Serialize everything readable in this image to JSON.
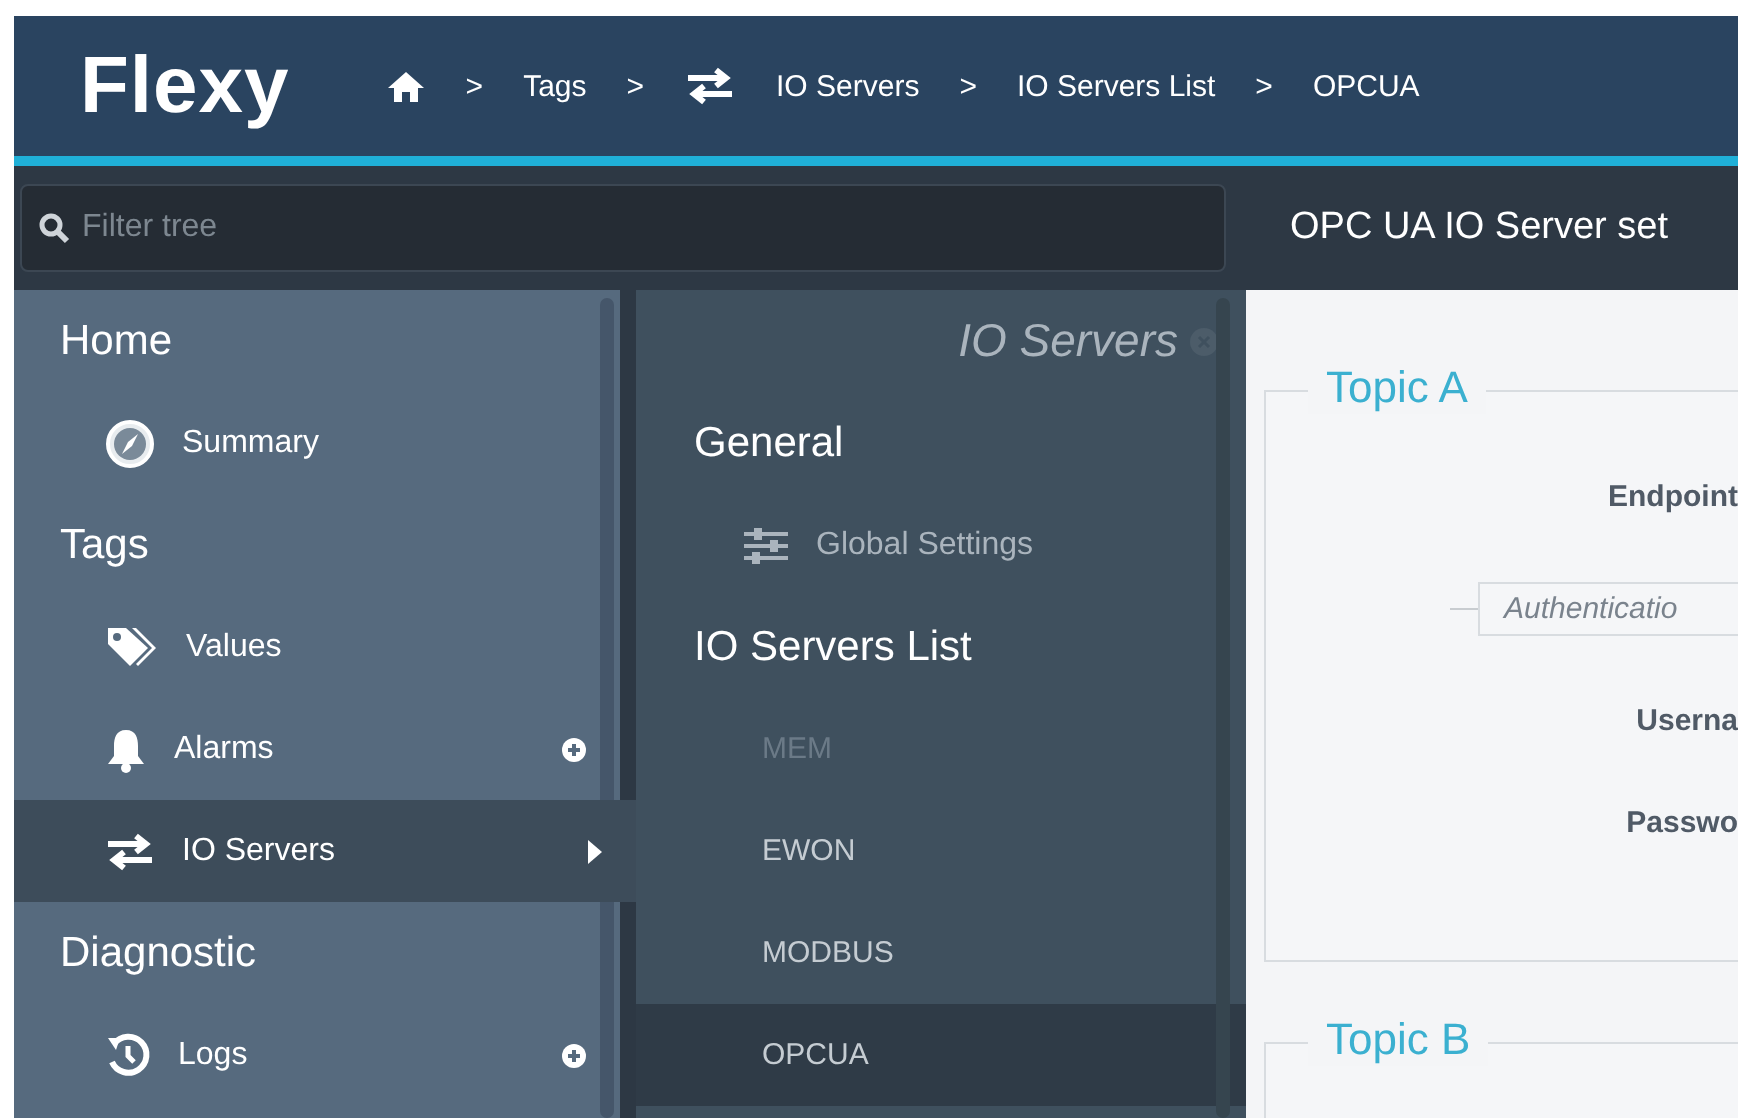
{
  "header": {
    "logo": "Flexy",
    "breadcrumb": [
      {
        "kind": "home"
      },
      {
        "kind": "separator",
        "label": ">"
      },
      {
        "kind": "link",
        "label": "Tags"
      },
      {
        "kind": "separator",
        "label": ">"
      },
      {
        "kind": "swap-link",
        "label": "IO Servers"
      },
      {
        "kind": "separator",
        "label": ">"
      },
      {
        "kind": "link",
        "label": "IO Servers List"
      },
      {
        "kind": "separator",
        "label": ">"
      },
      {
        "kind": "link",
        "label": "OPCUA"
      }
    ]
  },
  "filter": {
    "placeholder": "Filter tree"
  },
  "page_title": "OPC UA IO Server set",
  "sidebar": {
    "groups": [
      {
        "label": "Home",
        "items": [
          {
            "label": "Summary",
            "kind": "compass",
            "selected": false,
            "add": false
          }
        ]
      },
      {
        "label": "Tags",
        "items": [
          {
            "label": "Values",
            "kind": "tags",
            "selected": false,
            "add": false
          },
          {
            "label": "Alarms",
            "kind": "bell",
            "selected": false,
            "add": true
          },
          {
            "label": "IO Servers",
            "kind": "swap",
            "selected": true,
            "add": false
          }
        ]
      },
      {
        "label": "Diagnostic",
        "items": [
          {
            "label": "Logs",
            "kind": "history",
            "selected": false,
            "add": true
          }
        ]
      }
    ]
  },
  "subpanel": {
    "title": "IO Servers",
    "groups": [
      {
        "label": "General",
        "items": [
          {
            "label": "Global Settings",
            "kind": "sliders",
            "selected": false,
            "disabled": false
          }
        ]
      },
      {
        "label": "IO Servers List",
        "items": [
          {
            "label": "MEM",
            "selected": false,
            "disabled": true
          },
          {
            "label": "EWON",
            "selected": false,
            "disabled": false
          },
          {
            "label": "MODBUS",
            "selected": false,
            "disabled": false
          },
          {
            "label": "OPCUA",
            "selected": true,
            "disabled": false
          }
        ]
      }
    ]
  },
  "form": {
    "sections": [
      {
        "legend": "Topic A",
        "rows": [
          {
            "kind": "label",
            "text": "Endpoint"
          },
          {
            "kind": "subsection",
            "text": "Authenticatio"
          },
          {
            "kind": "label",
            "text": "Userna"
          },
          {
            "kind": "label",
            "text": "Passwo"
          }
        ]
      },
      {
        "legend": "Topic B"
      }
    ]
  }
}
